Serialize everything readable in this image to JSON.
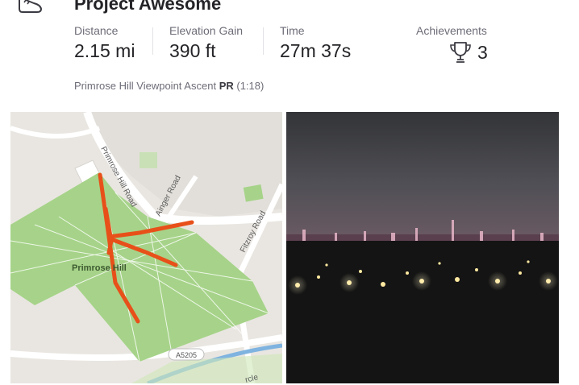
{
  "activity": {
    "title": "Project Awesome"
  },
  "stats": [
    {
      "label": "Distance",
      "value": "2.15 mi"
    },
    {
      "label": "Elevation Gain",
      "value": "390 ft"
    },
    {
      "label": "Time",
      "value": "27m 37s"
    }
  ],
  "achievements": {
    "label": "Achievements",
    "count": "3"
  },
  "segment": {
    "name": "Primrose Hill Viewpoint Ascent",
    "badge": "PR",
    "time": "(1:18)"
  },
  "map": {
    "park_label": "Primrose Hill",
    "roads": [
      "Primrose Hill Road",
      "Ainger Road",
      "Fitzroy Road"
    ],
    "road_shield": "A5205",
    "partial_label": "rcle",
    "route_color": "#e8501a",
    "park_color": "#a6d389"
  },
  "icons": {
    "activity_type": "shoe-icon",
    "achievements": "trophy-icon"
  }
}
